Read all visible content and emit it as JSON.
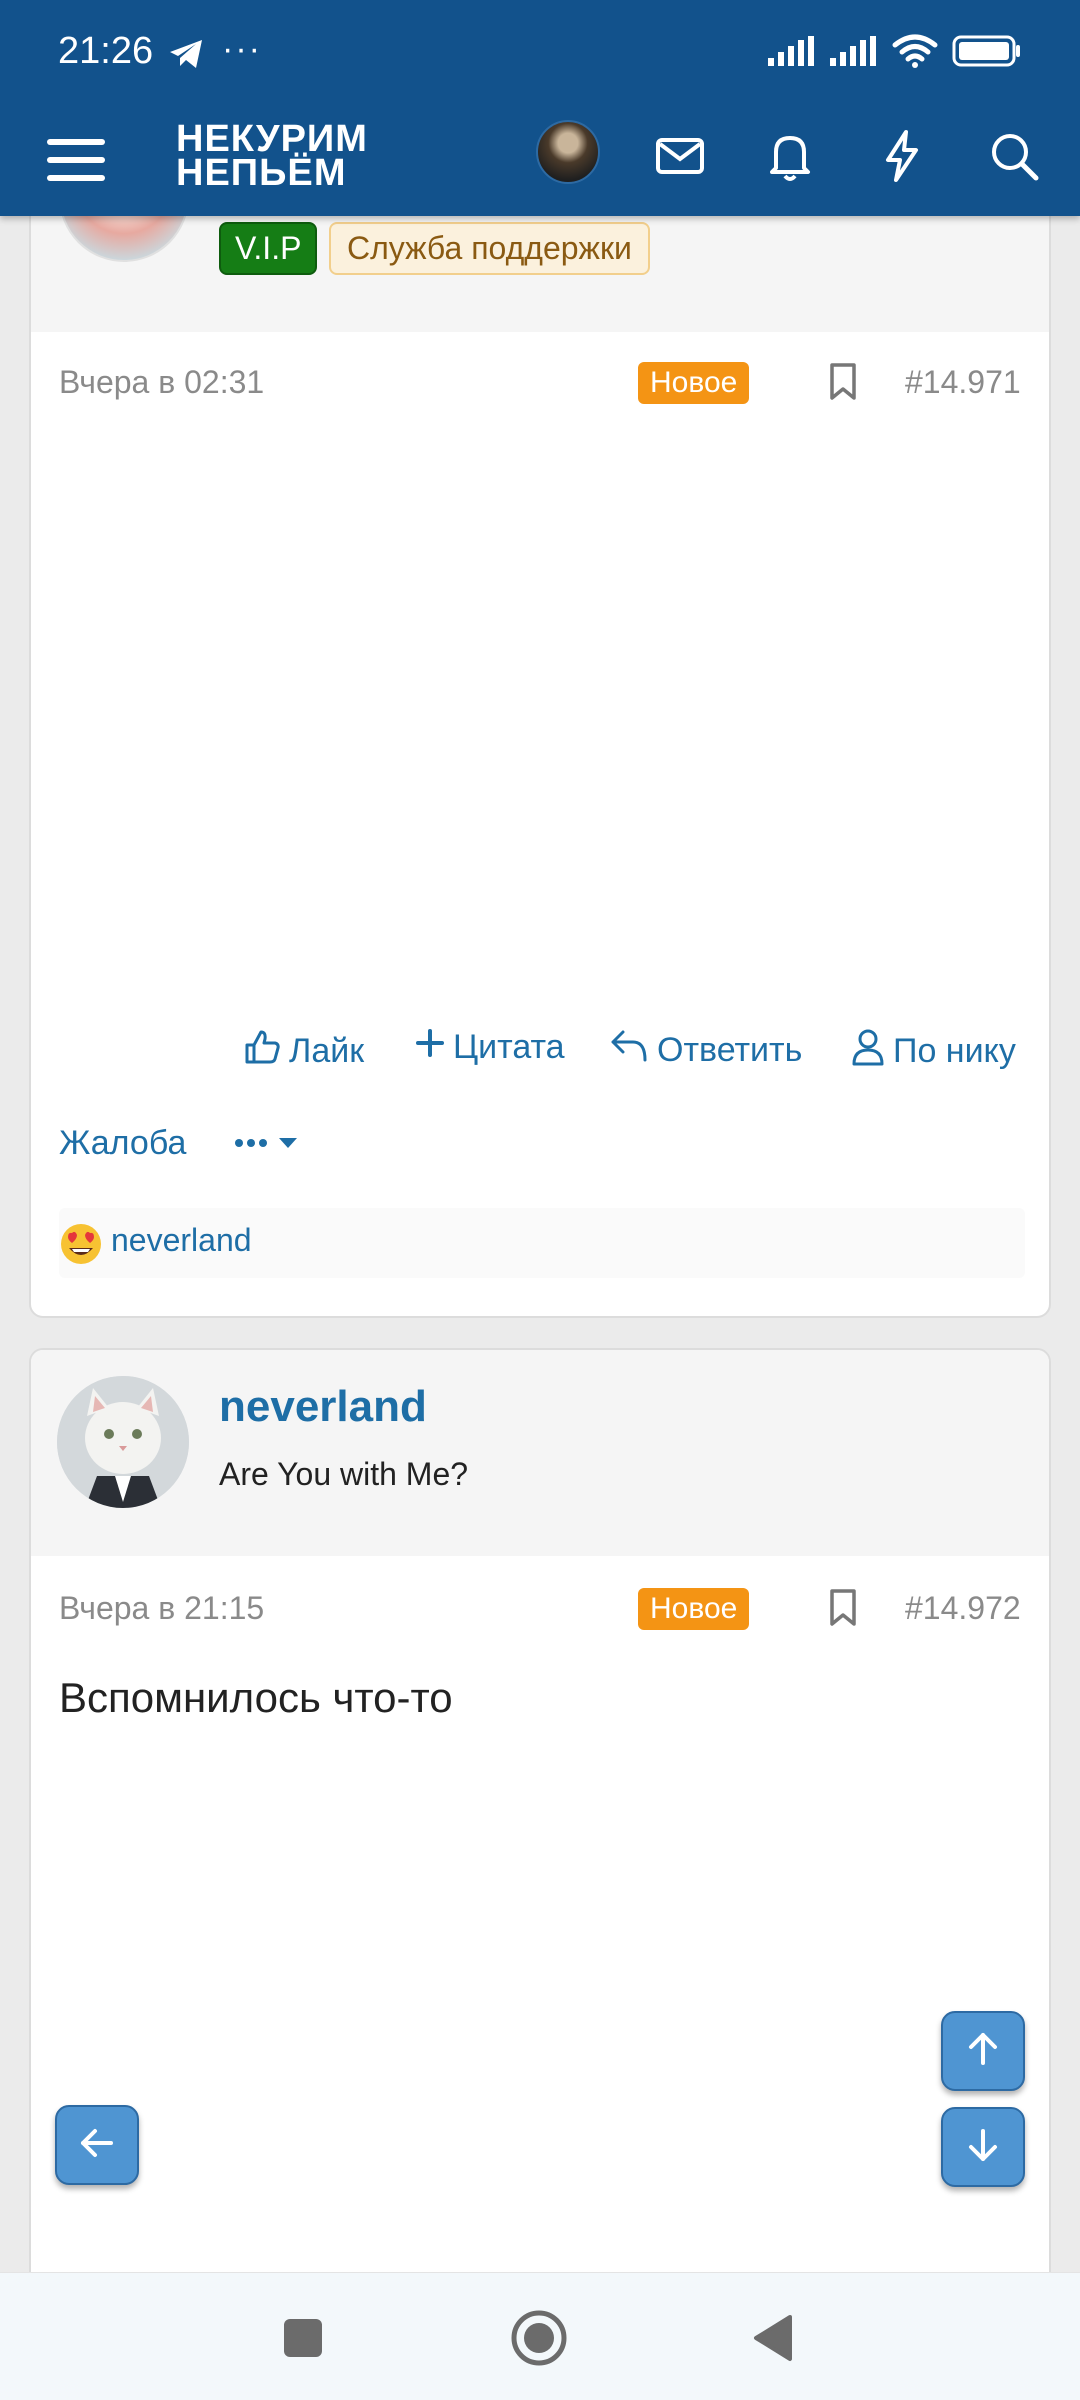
{
  "status_bar": {
    "time": "21:26",
    "dots": "···"
  },
  "header": {
    "logo_line1": "НЕКУРИМ",
    "logo_line2": "НЕПЬЁМ"
  },
  "icons": {
    "menu": "hamburger-icon",
    "mail": "envelope-icon",
    "bell": "bell-icon",
    "bolt": "lightning-icon",
    "search": "search-icon"
  },
  "colors": {
    "header_bg": "#12528c",
    "link": "#1e6ea6",
    "new_badge": "#f49414",
    "vip": "#157d15"
  },
  "post1": {
    "badges": {
      "vip": "V.I.P",
      "support": "Служба поддержки"
    },
    "date": "Вчера в 02:31",
    "new_label": "Новое",
    "number": "#14.971",
    "actions": {
      "like": "Лайк",
      "quote": "Цитата",
      "reply": "Ответить",
      "by_nick": "По нику"
    },
    "report": "Жалоба",
    "reaction_user": "neverland"
  },
  "post2": {
    "username": "neverland",
    "user_title": "Are You with Me?",
    "date": "Вчера в 21:15",
    "new_label": "Новое",
    "number": "#14.972",
    "body": "Вспомнилось что-то"
  }
}
